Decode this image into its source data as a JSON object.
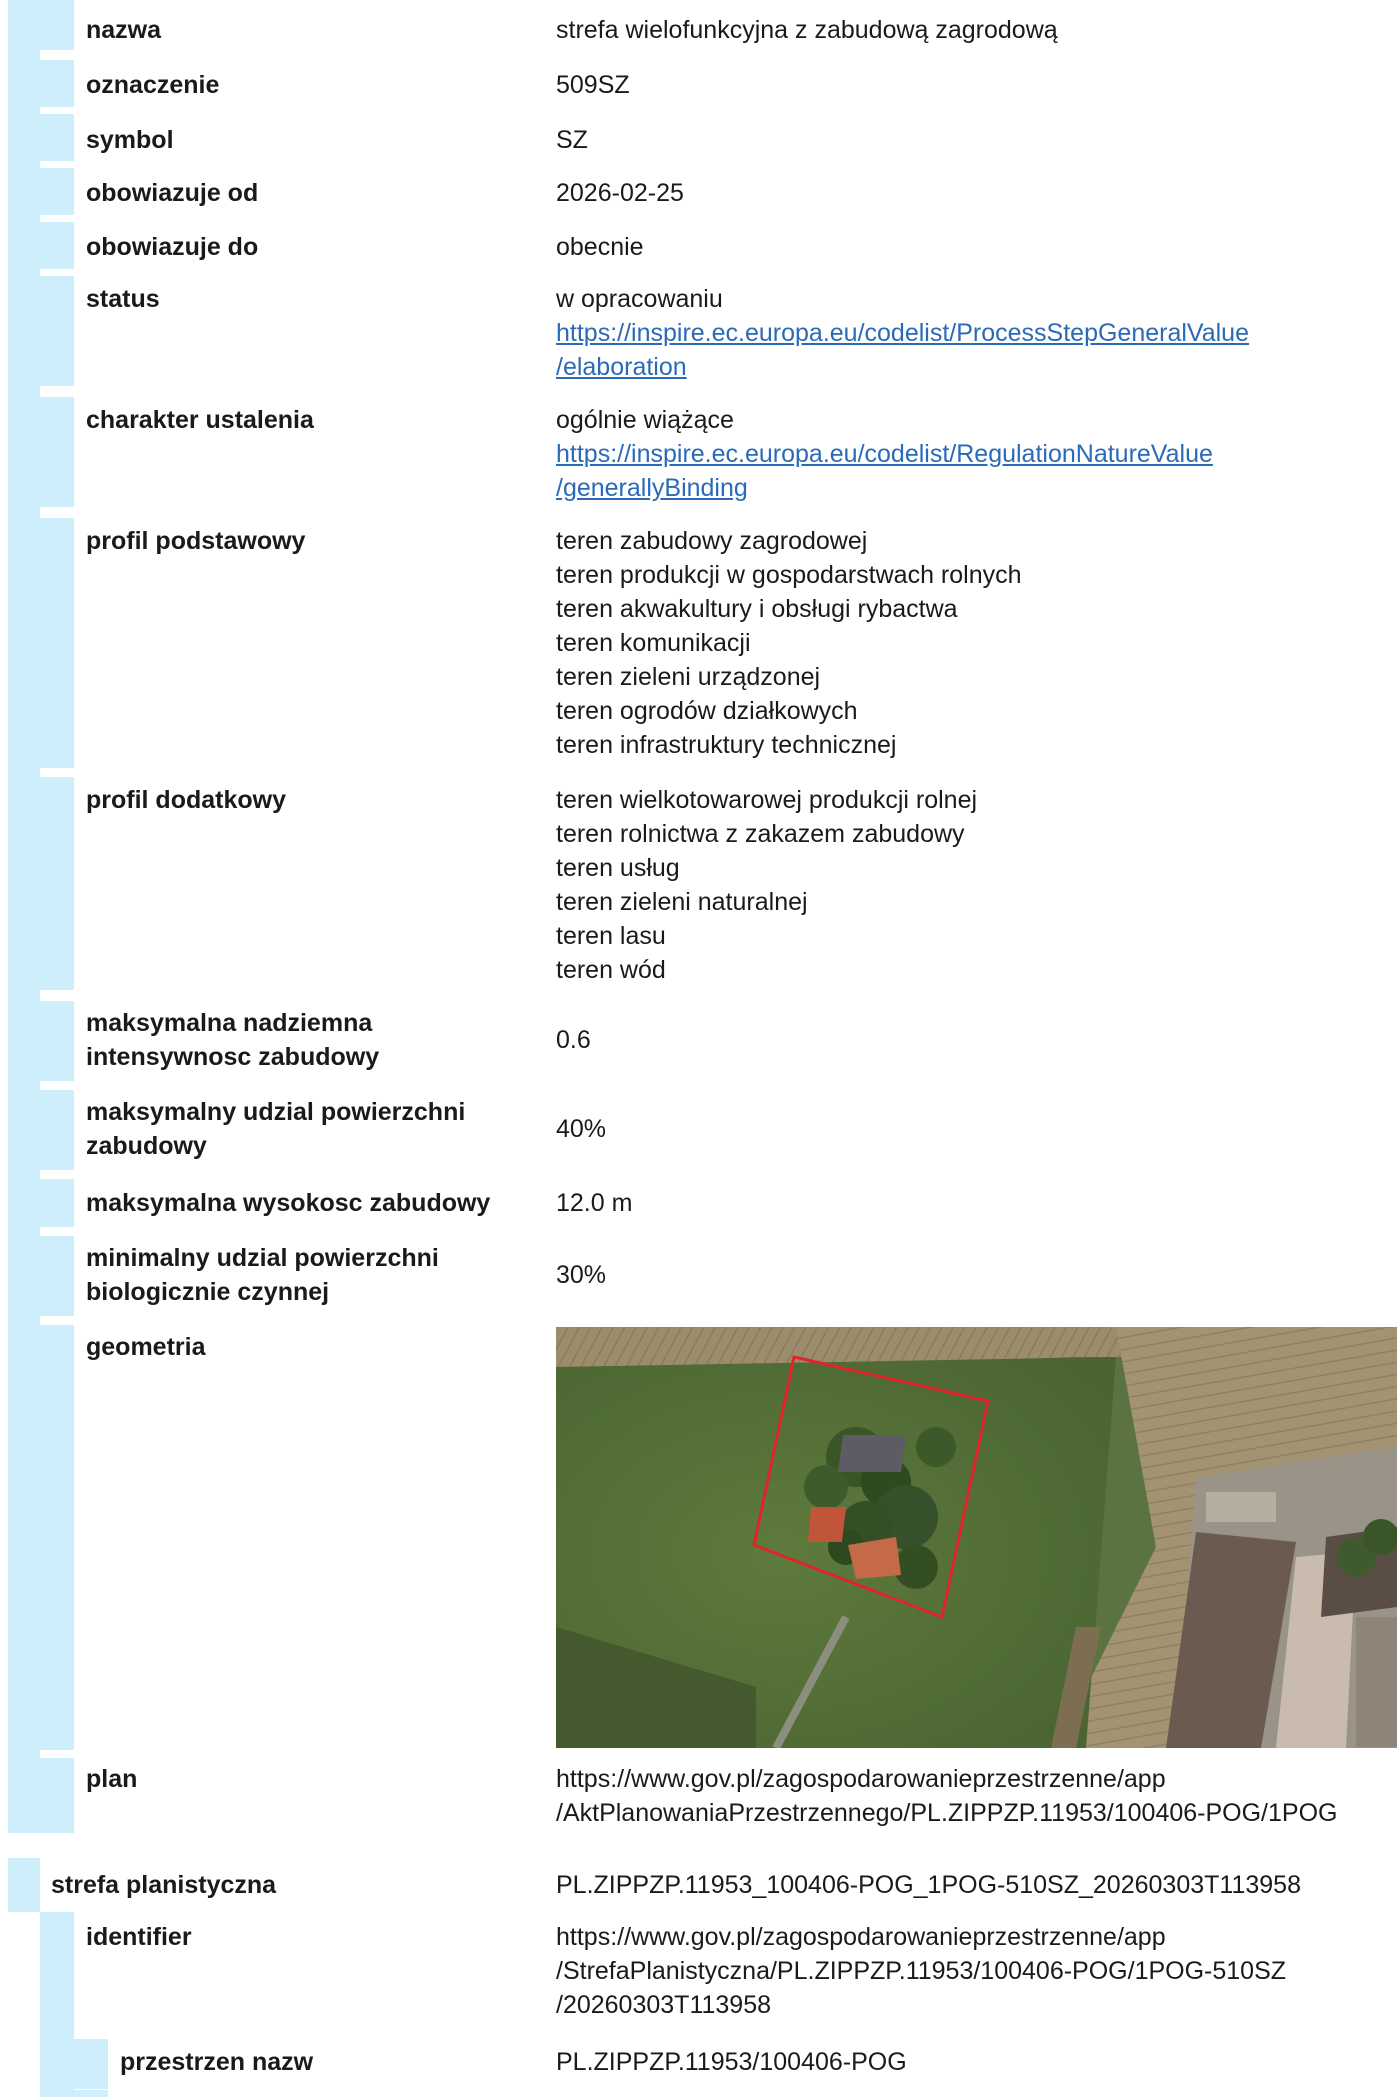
{
  "colors": {
    "strip": "#cfeefb",
    "link": "#2a6ab8",
    "text": "#1a1a1a",
    "boundary": "#e0242a"
  },
  "rows": [
    {
      "key": "nazwa",
      "value": "strefa wielofunkcyjna z zabudową zagrodową"
    },
    {
      "key": "oznaczenie",
      "value": "509SZ"
    },
    {
      "key": "symbol",
      "value": "SZ"
    },
    {
      "key": "obowiazuje od",
      "value": "2026-02-25"
    },
    {
      "key": "obowiazuje do",
      "value": "obecnie"
    },
    {
      "key": "status",
      "value": "w opracowaniu",
      "link1": "https://inspire.ec.europa.eu/codelist/ProcessStepGeneralValue",
      "link2": "/elaboration"
    },
    {
      "key": "charakter ustalenia",
      "value": "ogólnie wiążące",
      "link1": "https://inspire.ec.europa.eu/codelist/RegulationNatureValue",
      "link2": "/generallyBinding"
    },
    {
      "key": "profil podstawowy",
      "lines": [
        "teren zabudowy zagrodowej",
        "teren produkcji w gospodarstwach rolnych",
        "teren akwakultury i obsługi rybactwa",
        "teren komunikacji",
        "teren zieleni urządzonej",
        "teren ogrodów działkowych",
        "teren infrastruktury technicznej"
      ]
    },
    {
      "key": "profil dodatkowy",
      "lines": [
        "teren wielkotowarowej produkcji rolnej",
        "teren rolnictwa z zakazem zabudowy",
        "teren usług",
        "teren zieleni naturalnej",
        "teren lasu",
        "teren wód"
      ]
    },
    {
      "key1": "maksymalna nadziemna",
      "key2": "intensywnosc zabudowy",
      "value": "0.6"
    },
    {
      "key1": "maksymalny udzial powierzchni",
      "key2": "zabudowy",
      "value": "40%"
    },
    {
      "key": "maksymalna wysokosc zabudowy",
      "value": "12.0 m"
    },
    {
      "key1": "minimalny udzial powierzchni",
      "key2": "biologicznie czynnej",
      "value": "30%"
    },
    {
      "key": "geometria"
    },
    {
      "key": "plan",
      "line1": "https://www.gov.pl/zagospodarowanieprzestrzenne/app",
      "line2": "/AktPlanowaniaPrzestrzennego/PL.ZIPPZP.11953/100406-POG/1POG"
    }
  ],
  "zone2": {
    "key": "strefa planistyczna",
    "value": "PL.ZIPPZP.11953_100406-POG_1POG-510SZ_20260303T113958",
    "identifier": {
      "key": "identifier",
      "lines": [
        "https://www.gov.pl/zagospodarowanieprzestrzenne/app",
        "/StrefaPlanistyczna/PL.ZIPPZP.11953/100406-POG/1POG-510SZ",
        "/20260303T113958"
      ]
    },
    "namespace": {
      "key": "przestrzen nazw",
      "value": "PL.ZIPPZP.11953/100406-POG"
    }
  }
}
